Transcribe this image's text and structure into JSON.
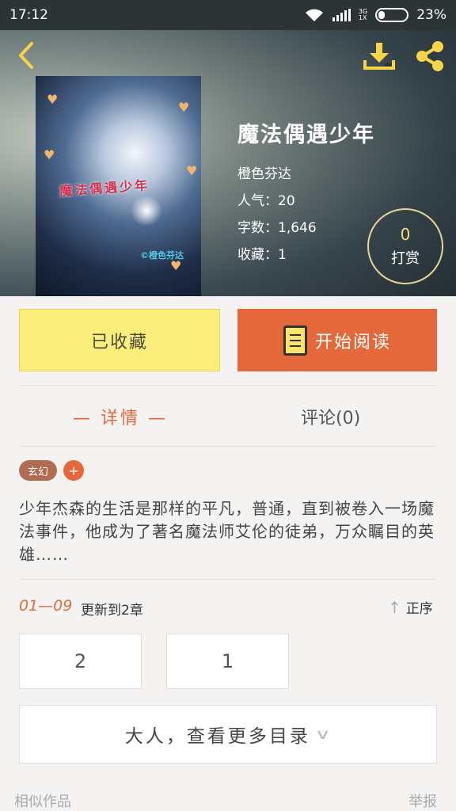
{
  "status_bar": {
    "time": "17:12",
    "network": "3G\n1X",
    "battery": "23%"
  },
  "book": {
    "title": "魔法偶遇少年",
    "author": "橙色芬达",
    "popularity_label": "人气：",
    "popularity": "20",
    "words_label": "字数：",
    "words": "1,646",
    "favorites_label": "收藏：",
    "favorites": "1",
    "cover_title": "魔法偶遇少年",
    "cover_author": "©橙色芬达"
  },
  "tip": {
    "count": "0",
    "label": "打赏"
  },
  "actions": {
    "favorited": "已收藏",
    "start_reading": "开始阅读"
  },
  "tabs": {
    "detail": "— 详情 —",
    "comments": "评论(0)"
  },
  "tags": {
    "genre": "玄幻",
    "add": "+"
  },
  "description": "少年杰森的生活是那样的平凡，普通，直到被卷入一场魔法事件，他成为了著名魔法师艾伦的徒弟，万众瞩目的英雄……",
  "update": {
    "date": "01—09",
    "text": "更新到2章",
    "sort": "正序"
  },
  "chapters": [
    "2",
    "1"
  ],
  "more_catalog": "大人，查看更多目录",
  "footer": {
    "similar": "相似作品",
    "report": "举报"
  },
  "colors": {
    "accent": "#e5683a",
    "favorite_bg": "#fbee7a",
    "icon_yellow": "#f7d546"
  }
}
